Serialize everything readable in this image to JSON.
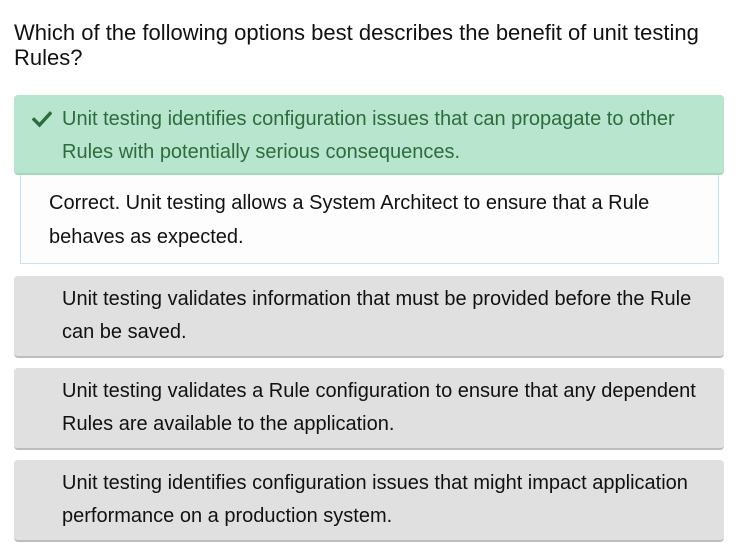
{
  "question": "Which of the following options best describes the benefit of unit testing Rules?",
  "options": [
    {
      "text": "Unit testing identifies configuration issues that can propagate to other Rules with potentially serious consequences.",
      "state": "correct",
      "icon": "check-icon"
    },
    {
      "text": "Unit testing validates information that must be provided before the Rule can be saved.",
      "state": "unselected"
    },
    {
      "text": "Unit testing validates a Rule configuration to ensure that any dependent Rules are available to the application.",
      "state": "unselected"
    },
    {
      "text": "Unit testing identifies configuration issues that might impact application performance on a production system.",
      "state": "unselected"
    }
  ],
  "feedback": "Correct. Unit testing allows a System Architect to ensure that a Rule behaves as expected.",
  "colors": {
    "correct_bg": "#b7e5cd",
    "correct_text": "#2f6b3e",
    "option_bg": "#e0e0e0"
  }
}
